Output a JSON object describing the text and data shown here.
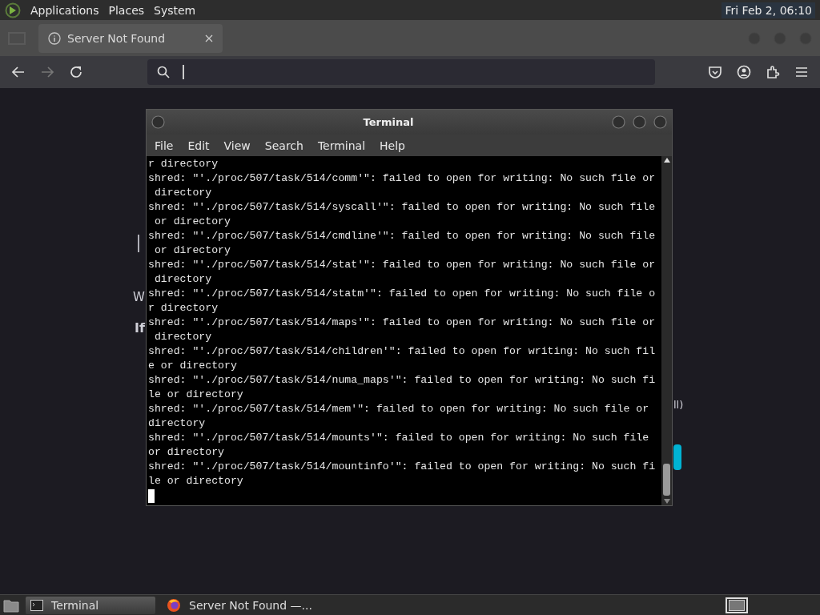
{
  "top_panel": {
    "menus": [
      "Applications",
      "Places",
      "System"
    ],
    "clock": "Fri Feb 2, 06:10"
  },
  "browser": {
    "tab": {
      "title": "Server Not Found",
      "selected": true
    },
    "page_fragments": [
      "W",
      "If",
      "ll)"
    ]
  },
  "terminal": {
    "title": "Terminal",
    "menus": [
      "File",
      "Edit",
      "View",
      "Search",
      "Terminal",
      "Help"
    ],
    "lines": [
      "r directory",
      "shred: \"'./proc/507/task/514/comm'\": failed to open for writing: No such file or",
      " directory",
      "shred: \"'./proc/507/task/514/syscall'\": failed to open for writing: No such file",
      " or directory",
      "shred: \"'./proc/507/task/514/cmdline'\": failed to open for writing: No such file",
      " or directory",
      "shred: \"'./proc/507/task/514/stat'\": failed to open for writing: No such file or",
      " directory",
      "shred: \"'./proc/507/task/514/statm'\": failed to open for writing: No such file o",
      "r directory",
      "shred: \"'./proc/507/task/514/maps'\": failed to open for writing: No such file or",
      " directory",
      "shred: \"'./proc/507/task/514/children'\": failed to open for writing: No such fil",
      "e or directory",
      "shred: \"'./proc/507/task/514/numa_maps'\": failed to open for writing: No such fi",
      "le or directory",
      "shred: \"'./proc/507/task/514/mem'\": failed to open for writing: No such file or",
      "directory",
      "shred: \"'./proc/507/task/514/mounts'\": failed to open for writing: No such file",
      "or directory",
      "shred: \"'./proc/507/task/514/mountinfo'\": failed to open for writing: No such fi",
      "le or directory"
    ]
  },
  "taskbar": {
    "tasks": [
      {
        "label": "Terminal",
        "kind": "terminal",
        "selected": true
      },
      {
        "label": "Server Not Found —...",
        "kind": "browser",
        "selected": false
      }
    ]
  }
}
